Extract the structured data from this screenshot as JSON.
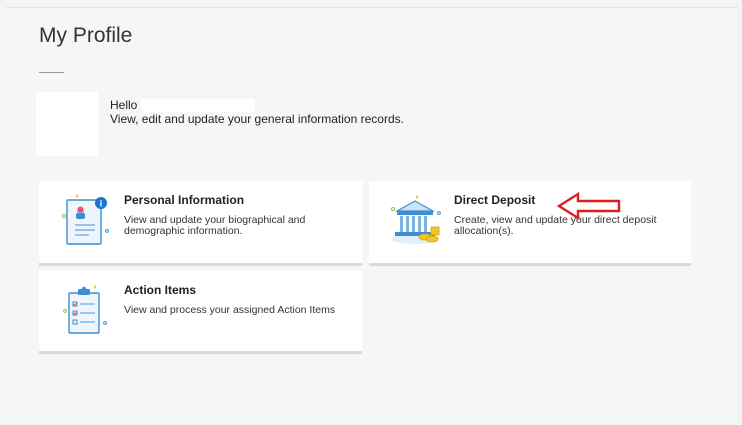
{
  "page": {
    "title": "My Profile",
    "greeting": "Hello",
    "subtitle": "View, edit and update your general information records."
  },
  "cards": [
    {
      "title": "Personal Information",
      "description": "View and update your biographical and demographic information.",
      "icon": "personal-info-icon"
    },
    {
      "title": "Direct Deposit",
      "description": "Create, view and update your direct deposit allocation(s).",
      "icon": "bank-icon"
    },
    {
      "title": "Action Items",
      "description": "View and process your assigned Action Items",
      "icon": "clipboard-checklist-icon"
    }
  ],
  "colors": {
    "icon_blue": "#3d8fd1",
    "icon_yellow": "#f4c430",
    "annotation_red": "#e01c1c"
  }
}
